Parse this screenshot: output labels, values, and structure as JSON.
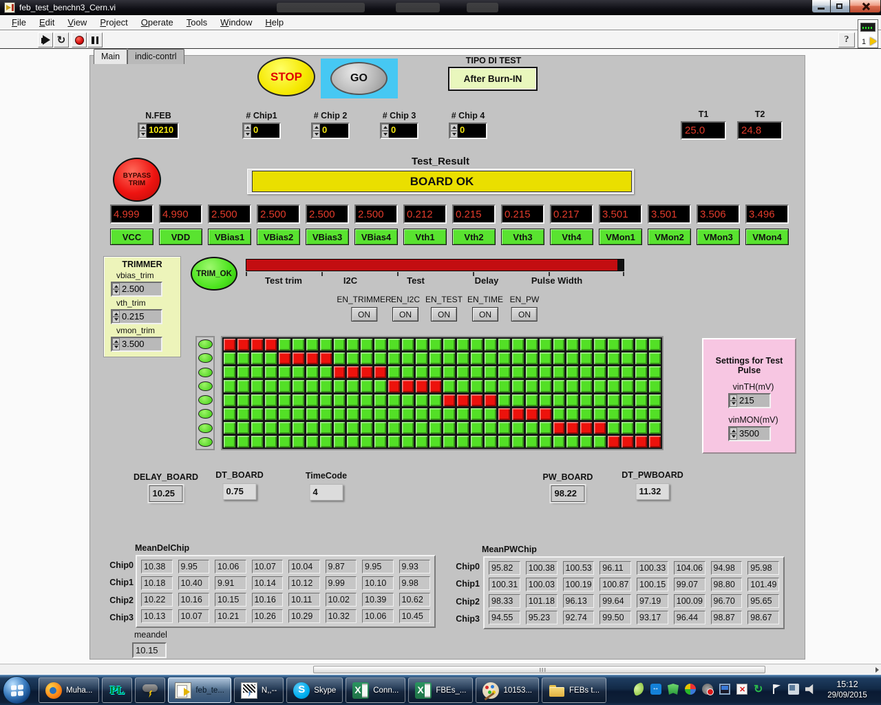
{
  "window": {
    "title": "feb_test_benchn3_Cern.vi"
  },
  "menu": {
    "items": [
      "File",
      "Edit",
      "View",
      "Project",
      "Operate",
      "Tools",
      "Window",
      "Help"
    ]
  },
  "toolbar": {
    "help_label": "?",
    "context_badge": "1"
  },
  "tabs": [
    {
      "label": "Main",
      "active": true
    },
    {
      "label": "indic-contrl",
      "active": false
    }
  ],
  "controls": {
    "stop_label": "STOP",
    "go_label": "GO",
    "tipo_label": "TIPO DI TEST",
    "tipo_value": "After Burn-IN",
    "bypass_line1": "BYPASS",
    "bypass_line2": "TRIM",
    "trim_ok_label": "TRIM_OK"
  },
  "feb": {
    "label": "N.FEB",
    "value": "10210"
  },
  "chips": [
    {
      "label": "# Chip1",
      "value": "0"
    },
    {
      "label": "# Chip 2",
      "value": "0"
    },
    {
      "label": "# Chip 3",
      "value": "0"
    },
    {
      "label": "# Chip 4",
      "value": "0"
    }
  ],
  "temps": [
    {
      "label": "T1",
      "value": "25.0"
    },
    {
      "label": "T2",
      "value": "24.8"
    }
  ],
  "test_result": {
    "label": "Test_Result",
    "value": "BOARD OK"
  },
  "measurements": [
    {
      "value": "4.999",
      "label": "VCC"
    },
    {
      "value": "4.990",
      "label": "VDD"
    },
    {
      "value": "2.500",
      "label": "VBias1"
    },
    {
      "value": "2.500",
      "label": "VBias2"
    },
    {
      "value": "2.500",
      "label": "VBias3"
    },
    {
      "value": "2.500",
      "label": "VBias4"
    },
    {
      "value": "0.212",
      "label": "Vth1"
    },
    {
      "value": "0.215",
      "label": "Vth2"
    },
    {
      "value": "0.215",
      "label": "Vth3"
    },
    {
      "value": "0.217",
      "label": "Vth4"
    },
    {
      "value": "3.501",
      "label": "VMon1"
    },
    {
      "value": "3.501",
      "label": "VMon2"
    },
    {
      "value": "3.506",
      "label": "VMon3"
    },
    {
      "value": "3.496",
      "label": "VMon4"
    }
  ],
  "trimmer": {
    "title": "TRIMMER",
    "fields": [
      {
        "label": "vbias_trim",
        "value": "2.500"
      },
      {
        "label": "vth_trim",
        "value": "0.215"
      },
      {
        "label": "vmon_trim",
        "value": "3.500"
      }
    ]
  },
  "progress": {
    "stages": [
      "Test trim",
      "I2C",
      "Test",
      "Delay",
      "Pulse Width"
    ]
  },
  "enables": [
    {
      "label": "EN_TRIMMER",
      "value": "ON"
    },
    {
      "label": "EN_I2C",
      "value": "ON"
    },
    {
      "label": "EN_TEST",
      "value": "ON"
    },
    {
      "label": "EN_TIME",
      "value": "ON"
    },
    {
      "label": "EN_PW",
      "value": "ON"
    }
  ],
  "led_matrix": {
    "rows": 8,
    "cols": 32,
    "row_leds": 8,
    "red_cells": [
      [
        0,
        1,
        2,
        3
      ],
      [
        4,
        5,
        6,
        7
      ],
      [
        8,
        9,
        10,
        11
      ],
      [
        12,
        13,
        14,
        15
      ],
      [
        16,
        17,
        18,
        19
      ],
      [
        20,
        21,
        22,
        23
      ],
      [
        24,
        25,
        26,
        27
      ],
      [
        28,
        29,
        30,
        31
      ]
    ]
  },
  "test_pulse": {
    "title": "Settings for Test Pulse",
    "fields": [
      {
        "label": "vinTH(mV)",
        "value": "215"
      },
      {
        "label": "vinMON(mV)",
        "value": "3500"
      }
    ]
  },
  "board_stats": [
    {
      "label": "DELAY_BOARD",
      "value": "10.25"
    },
    {
      "label": "DT_BOARD",
      "value": "0.75"
    },
    {
      "label": "TimeCode",
      "value": "4"
    },
    {
      "label": "PW_BOARD",
      "value": "98.22"
    },
    {
      "label": "DT_PWBOARD",
      "value": "11.32"
    }
  ],
  "mean_del": {
    "title": "MeanDelChip",
    "row_labels": [
      "Chip0",
      "Chip1",
      "Chip2",
      "Chip3"
    ],
    "rows": [
      [
        "10.38",
        "9.95",
        "10.06",
        "10.07",
        "10.04",
        "9.87",
        "9.95",
        "9.93"
      ],
      [
        "10.18",
        "10.40",
        "9.91",
        "10.14",
        "10.12",
        "9.99",
        "10.10",
        "9.98"
      ],
      [
        "10.22",
        "10.16",
        "10.15",
        "10.16",
        "10.11",
        "10.02",
        "10.39",
        "10.62"
      ],
      [
        "10.13",
        "10.07",
        "10.21",
        "10.26",
        "10.29",
        "10.32",
        "10.06",
        "10.45"
      ]
    ]
  },
  "mean_pw": {
    "title": "MeanPWChip",
    "row_labels": [
      "Chip0",
      "Chip1",
      "Chip2",
      "Chip3"
    ],
    "rows": [
      [
        "95.82",
        "100.38",
        "100.53",
        "96.11",
        "100.33",
        "104.06",
        "94.98",
        "95.98"
      ],
      [
        "100.31",
        "100.03",
        "100.19",
        "100.87",
        "100.15",
        "99.07",
        "98.80",
        "101.49"
      ],
      [
        "98.33",
        "101.18",
        "96.13",
        "99.64",
        "97.19",
        "100.09",
        "96.70",
        "95.65"
      ],
      [
        "94.55",
        "95.23",
        "92.74",
        "99.50",
        "93.17",
        "96.44",
        "98.87",
        "98.67"
      ]
    ]
  },
  "meandel": {
    "label": "meandel",
    "value": "10.15"
  },
  "colors": {
    "led_green": "#53e026",
    "led_red": "#ed120c",
    "result_yellow": "#eadf00",
    "progress_red": "#c30d11",
    "panel_lime": "#edf4ba",
    "panel_pink": "#f7c6e2",
    "go_cyan": "#46c8f3",
    "digit_red": "#e23b2b",
    "digit_yellow": "#f3e711"
  },
  "taskbar": {
    "buttons": [
      {
        "icon": "firefox",
        "label": "Muha...",
        "active": false
      },
      {
        "icon": "pl",
        "label": "",
        "active": false
      },
      {
        "icon": "storm",
        "label": "",
        "active": false
      },
      {
        "icon": "labview",
        "label": "feb_te...",
        "active": true
      },
      {
        "icon": "stormbw",
        "label": "N,,--",
        "active": false
      },
      {
        "icon": "skype",
        "label": "Skype",
        "active": false
      },
      {
        "icon": "excel",
        "label": "Conn...",
        "active": false
      },
      {
        "icon": "excel",
        "label": "FBEs_...",
        "active": false
      },
      {
        "icon": "paint",
        "label": "10153...",
        "active": false
      },
      {
        "icon": "folder",
        "label": "FEBs t...",
        "active": false
      }
    ],
    "tray": [
      "leaf",
      "teamviewer",
      "shield",
      "brush",
      "gear",
      "display",
      "doc-error",
      "refresh",
      "flag",
      "network",
      "volume"
    ],
    "clock": {
      "time": "15:12",
      "date": "29/09/2015"
    }
  }
}
